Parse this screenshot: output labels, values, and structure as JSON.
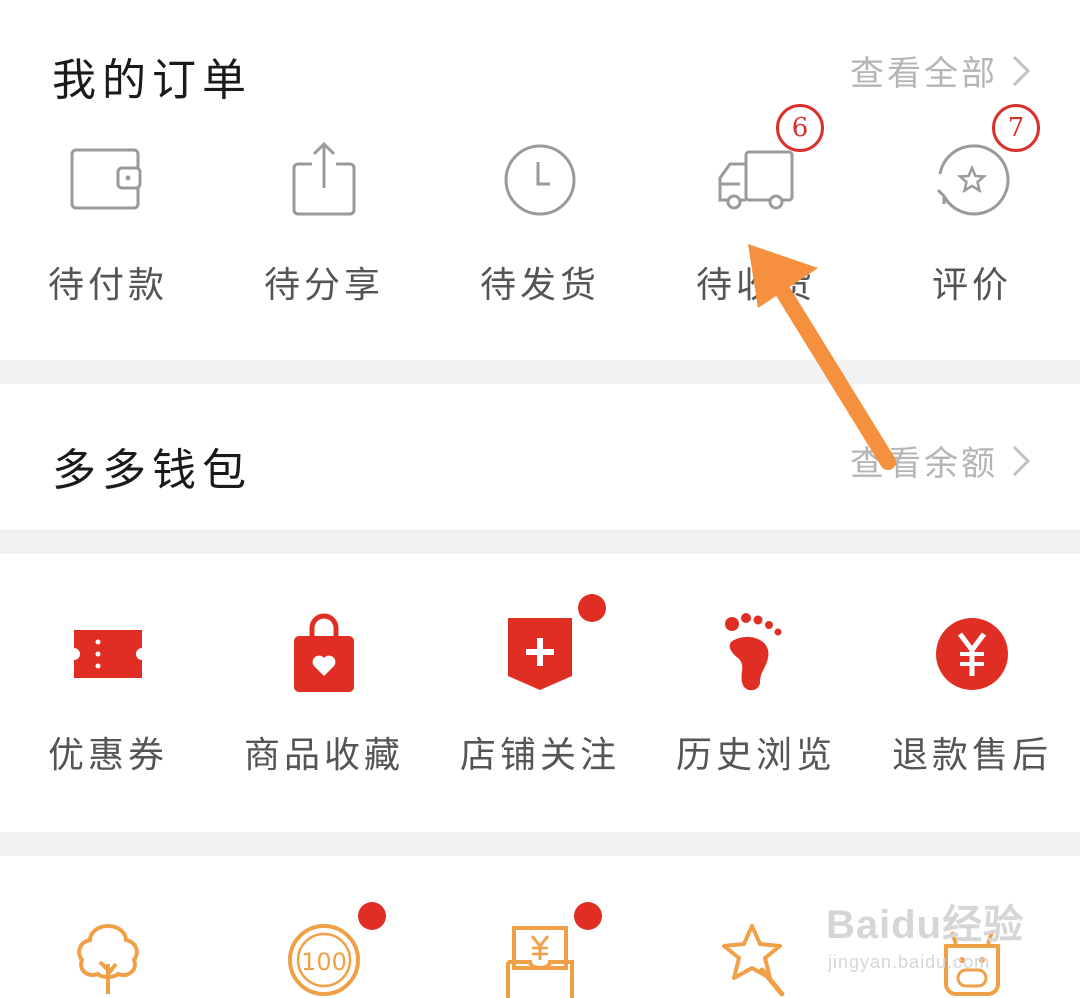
{
  "orders": {
    "title": "我的订单",
    "view_all": "查看全部",
    "items": [
      {
        "label": "待付款",
        "icon": "wallet-icon"
      },
      {
        "label": "待分享",
        "icon": "share-icon"
      },
      {
        "label": "待发货",
        "icon": "clock-icon"
      },
      {
        "label": "待收货",
        "icon": "delivery-truck-icon",
        "badge": "6"
      },
      {
        "label": "评价",
        "icon": "review-star-icon",
        "badge": "7"
      }
    ]
  },
  "wallet": {
    "title": "多多钱包",
    "view_balance": "查看余额"
  },
  "services": {
    "items": [
      {
        "label": "优惠券",
        "icon": "coupon-icon"
      },
      {
        "label": "商品收藏",
        "icon": "favorite-bag-icon"
      },
      {
        "label": "店铺关注",
        "icon": "store-follow-icon",
        "dot": true
      },
      {
        "label": "历史浏览",
        "icon": "footprint-icon"
      },
      {
        "label": "退款售后",
        "icon": "refund-yen-icon"
      }
    ]
  },
  "more": {
    "items": [
      {
        "icon": "tree-icon"
      },
      {
        "icon": "coin-100-icon",
        "dot": true,
        "coin_text": "100"
      },
      {
        "icon": "yen-envelope-icon",
        "dot": true
      },
      {
        "icon": "magic-wand-star-icon"
      },
      {
        "icon": "cow-face-icon"
      }
    ]
  },
  "watermark": {
    "main": "Baidu经验",
    "sub": "jingyan.baidu.com"
  },
  "colors": {
    "accent_red": "#e02e24",
    "icon_gray": "#9a9a9a",
    "orange": "#f0a046",
    "arrow": "#f5913e",
    "badge": "#d9302a"
  }
}
